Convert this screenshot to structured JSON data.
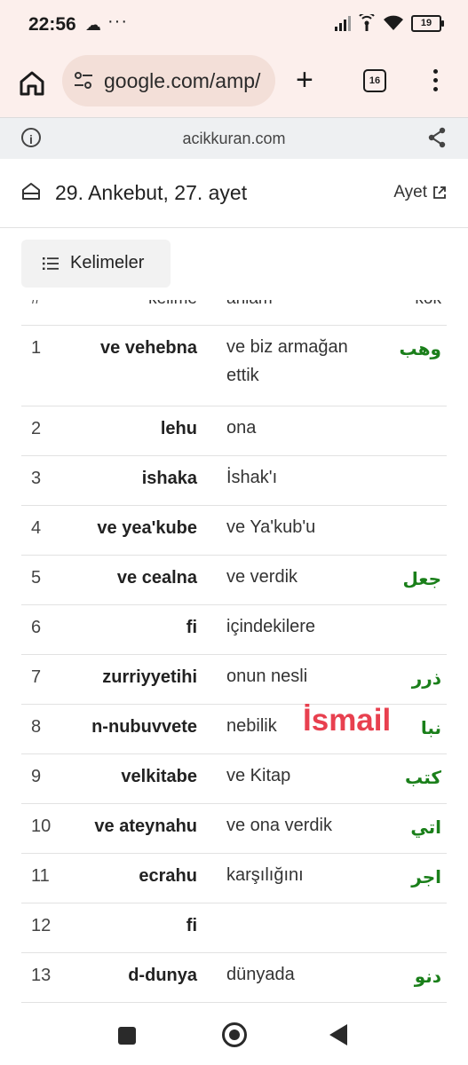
{
  "status": {
    "time": "22:56",
    "battery": "19"
  },
  "browser": {
    "url": "google.com/amp/",
    "tab_count": "16"
  },
  "amp_bar": {
    "domain": "acikkuran.com"
  },
  "header": {
    "title": "29. Ankebut, 27. ayet",
    "ayet_link": "Ayet"
  },
  "words_button": {
    "label": "Kelimeler"
  },
  "table": {
    "headers": {
      "num": "#",
      "word": "kelime",
      "meaning": "anlam",
      "root": "kök"
    },
    "rows": [
      {
        "num": "1",
        "word": "ve vehebna",
        "meaning": "ve biz armağan ettik",
        "root": "وهب"
      },
      {
        "num": "2",
        "word": "lehu",
        "meaning": "ona",
        "root": ""
      },
      {
        "num": "3",
        "word": "ishaka",
        "meaning": "İshak'ı",
        "root": ""
      },
      {
        "num": "4",
        "word": "ve yea'kube",
        "meaning": "ve Ya'kub'u",
        "root": ""
      },
      {
        "num": "5",
        "word": "ve cealna",
        "meaning": "ve verdik",
        "root": "جعل"
      },
      {
        "num": "6",
        "word": "fi",
        "meaning": "içindekilere",
        "root": ""
      },
      {
        "num": "7",
        "word": "zurriyyetihi",
        "meaning": "onun nesli",
        "root": "ذرر"
      },
      {
        "num": "8",
        "word": "n-nubuvvete",
        "meaning": "nebilik",
        "root": "نبا"
      },
      {
        "num": "9",
        "word": "velkitabe",
        "meaning": "ve Kitap",
        "root": "كتب"
      },
      {
        "num": "10",
        "word": "ve ateynahu",
        "meaning": "ve ona verdik",
        "root": "اتي"
      },
      {
        "num": "11",
        "word": "ecrahu",
        "meaning": "karşılığını",
        "root": "اجر"
      },
      {
        "num": "12",
        "word": "fi",
        "meaning": "",
        "root": ""
      },
      {
        "num": "13",
        "word": "d-dunya",
        "meaning": "dünyada",
        "root": "دنو"
      }
    ]
  },
  "annotation": {
    "text": "İsmail",
    "color": "#e8404f"
  },
  "colors": {
    "root_green": "#1a7f1a",
    "browser_bar": "#fcefec"
  }
}
